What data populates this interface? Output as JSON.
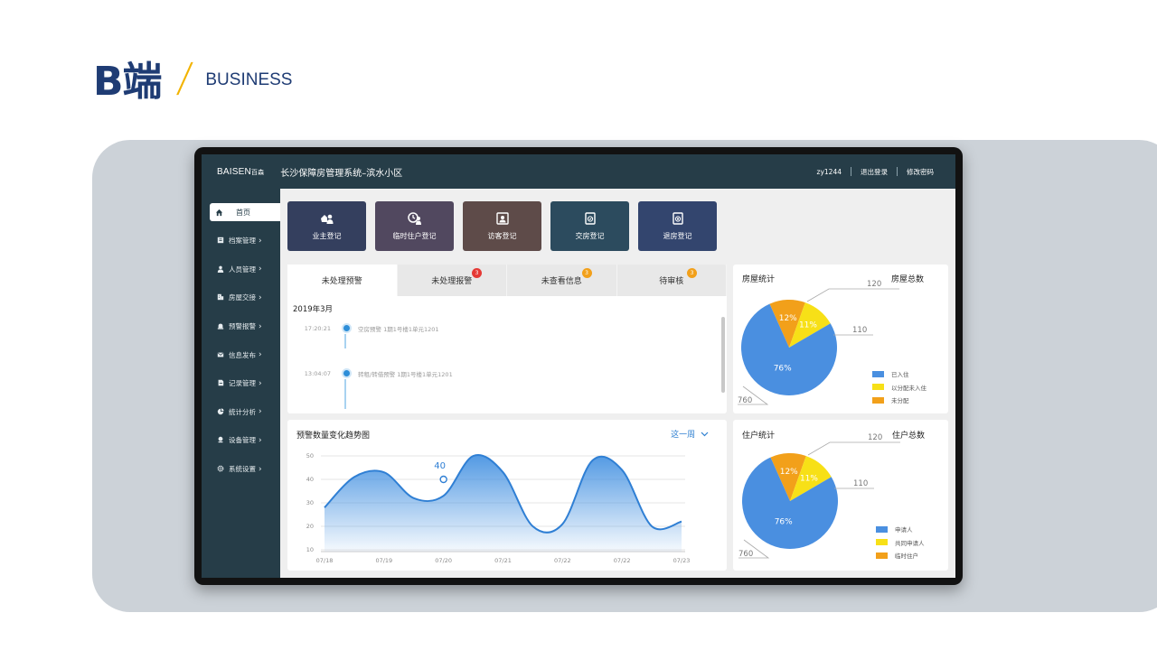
{
  "slide": {
    "title_big": "B端",
    "slash": "/",
    "title_sub": "BUSINESS"
  },
  "topbar": {
    "brand": "BAISEN",
    "brand_cn": "百森",
    "system_title": "长沙保障房管理系统–滨水小区",
    "user": "zy1244",
    "logout": "退出登录",
    "change_password": "修改密码"
  },
  "sidebar": {
    "items": [
      {
        "label": "首页",
        "icon": "home-icon"
      },
      {
        "label": "档案管理",
        "icon": "archive-icon"
      },
      {
        "label": "人员管理",
        "icon": "user-icon"
      },
      {
        "label": "房屋交接",
        "icon": "building-icon"
      },
      {
        "label": "预警报警",
        "icon": "alarm-icon"
      },
      {
        "label": "信息发布",
        "icon": "mail-icon"
      },
      {
        "label": "记录管理",
        "icon": "record-icon"
      },
      {
        "label": "统计分析",
        "icon": "pie-icon"
      },
      {
        "label": "设备管理",
        "icon": "device-icon"
      },
      {
        "label": "系统设置",
        "icon": "gear-icon"
      }
    ]
  },
  "quick_actions": [
    {
      "label": "业主登记",
      "color": "#343f5e",
      "icon": "owner-icon"
    },
    {
      "label": "临时住户登记",
      "color": "#51485f",
      "icon": "temp-resident-icon"
    },
    {
      "label": "访客登记",
      "color": "#5e4b49",
      "icon": "visitor-icon"
    },
    {
      "label": "交房登记",
      "color": "#2c4b5e",
      "icon": "handover-icon"
    },
    {
      "label": "退房登记",
      "color": "#33456e",
      "icon": "checkout-icon"
    }
  ],
  "alerts": {
    "tabs": [
      {
        "label": "未处理预警",
        "badge": ""
      },
      {
        "label": "未处理报警",
        "badge": "3",
        "badge_color": "#e53935"
      },
      {
        "label": "未查看信息",
        "badge": "3",
        "badge_color": "#f2a01a"
      },
      {
        "label": "待审核",
        "badge": "3",
        "badge_color": "#f2a01a"
      }
    ],
    "month": "2019年3月",
    "entries": [
      {
        "time": "17:20:21",
        "text": "空房预警 1期1号楼1单元1201"
      },
      {
        "time": "13:04:07",
        "text": "转租/转借预警  1期1号楼1单元1201"
      }
    ]
  },
  "trend": {
    "title": "预警数量变化趋势图",
    "range_select": "这一周",
    "highlight_label": "40"
  },
  "house_stats": {
    "title": "房屋统计",
    "total_label": "房屋总数",
    "callouts": [
      "120",
      "110",
      "760"
    ],
    "legend": [
      "已入住",
      "以分配未入住",
      "未分配"
    ]
  },
  "resident_stats": {
    "title": "住户统计",
    "total_label": "住户总数",
    "callouts": [
      "120",
      "110",
      "760"
    ],
    "legend": [
      "申请人",
      "共同申请人",
      "临时住户"
    ]
  },
  "chart_data": [
    {
      "type": "area",
      "title": "预警数量变化趋势图",
      "x": [
        "07/18",
        "07/19",
        "07/20",
        "07/21",
        "07/22",
        "07/22",
        "07/23"
      ],
      "ylim": [
        10,
        50
      ],
      "yticks": [
        10,
        20,
        30,
        40,
        50
      ],
      "series": [
        {
          "points": [
            [
              0,
              28
            ],
            [
              0.5,
              41
            ],
            [
              1,
              43
            ],
            [
              1.5,
              32
            ],
            [
              2,
              33
            ],
            [
              2.5,
              50
            ],
            [
              3,
              43
            ],
            [
              3.5,
              20
            ],
            [
              4,
              21
            ],
            [
              4.5,
              48
            ],
            [
              5,
              44
            ],
            [
              5.5,
              20
            ],
            [
              6,
              22
            ]
          ]
        }
      ],
      "highlight": {
        "x": 2,
        "y": 40
      }
    },
    {
      "type": "pie",
      "title": "房屋统计",
      "labels": [
        "已入住",
        "以分配未入住",
        "未分配"
      ],
      "values": [
        76,
        11,
        12
      ],
      "colors": [
        "#4a8fe0",
        "#f7e017",
        "#f2a01a"
      ]
    },
    {
      "type": "pie",
      "title": "住户统计",
      "labels": [
        "申请人",
        "共同申请人",
        "临时住户"
      ],
      "values": [
        76,
        11,
        12
      ],
      "colors": [
        "#4a8fe0",
        "#f7e017",
        "#f2a01a"
      ]
    }
  ]
}
